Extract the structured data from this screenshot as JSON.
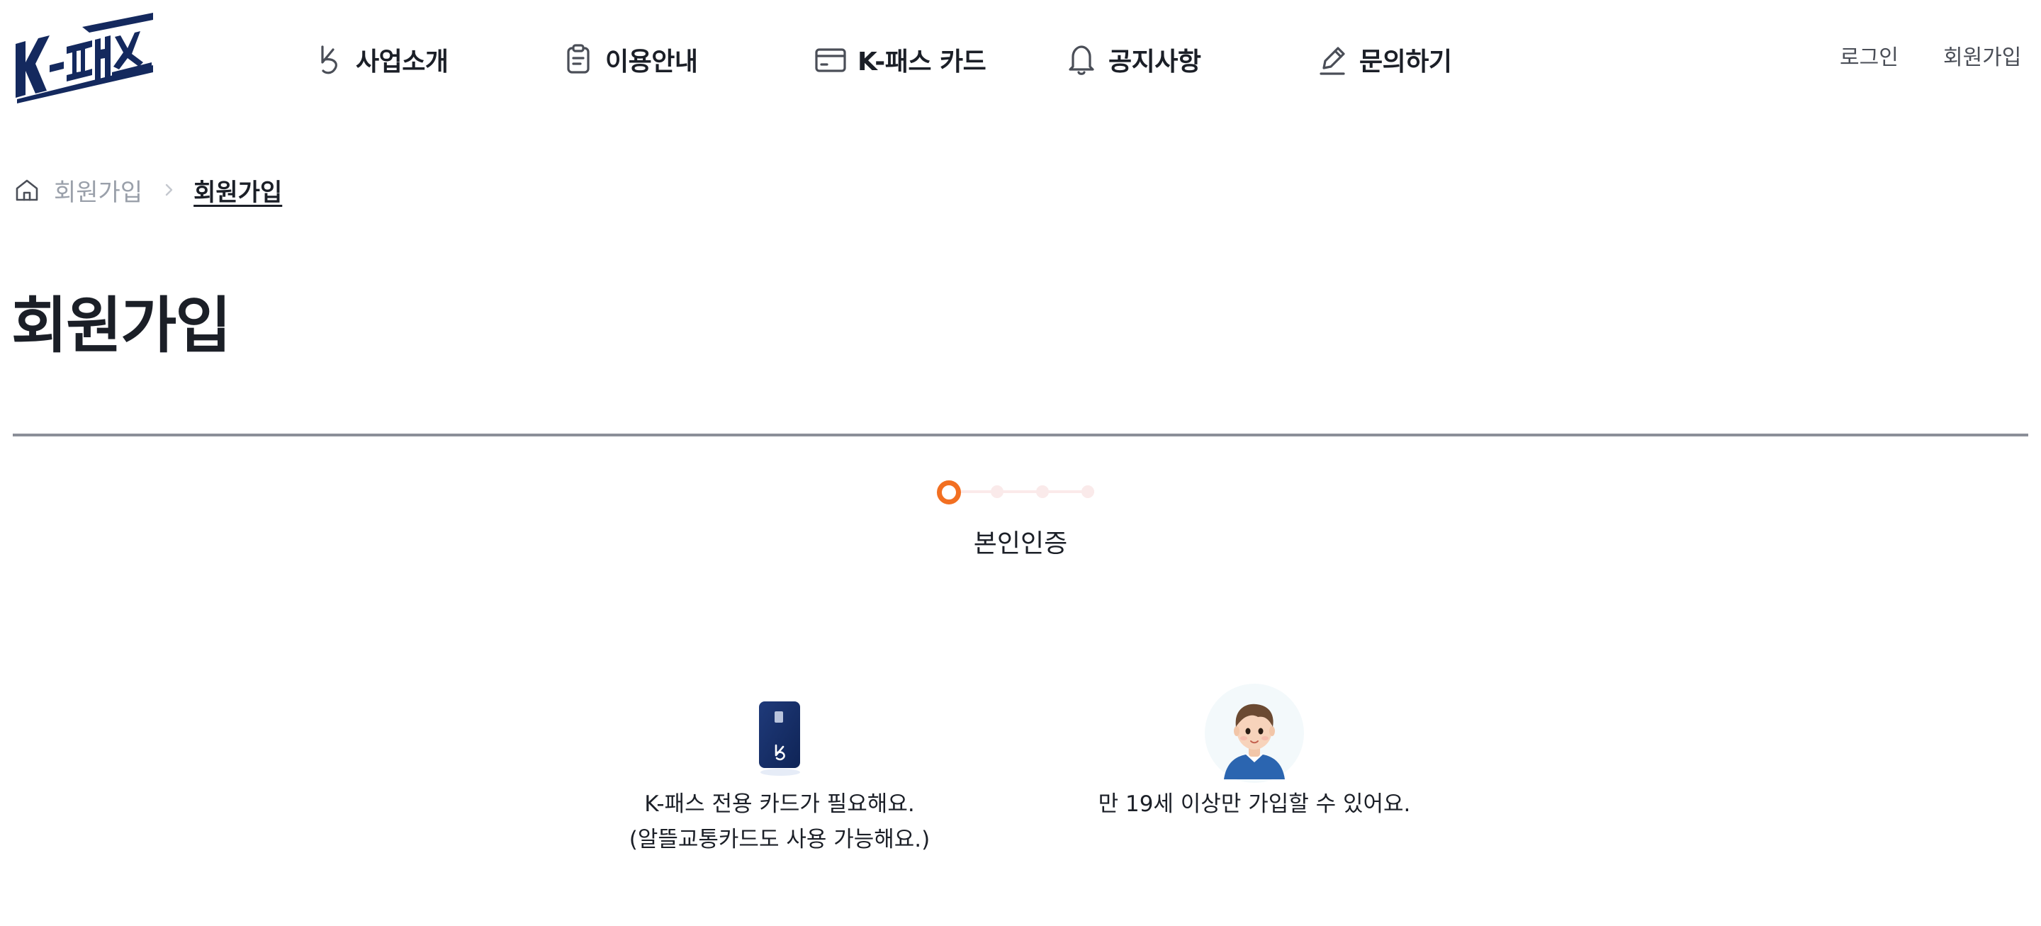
{
  "brand": {
    "logo_text": "K-패스",
    "navy": "#14295e",
    "accent": "#f26f21"
  },
  "gnb": [
    {
      "label": "사업소개",
      "icon": "k-swirl-icon"
    },
    {
      "label": "이용안내",
      "icon": "clipboard-icon"
    },
    {
      "label": "K-패스 카드",
      "icon": "credit-card-icon"
    },
    {
      "label": "공지사항",
      "icon": "bell-icon"
    },
    {
      "label": "문의하기",
      "icon": "pencil-icon"
    }
  ],
  "util": {
    "login": "로그인",
    "join": "회원가입"
  },
  "breadcrumb": {
    "home_icon": "home-icon",
    "parent": "회원가입",
    "current": "회원가입"
  },
  "page": {
    "title": "회원가입"
  },
  "stepper": {
    "total_steps": 4,
    "current_step": 1,
    "current_label": "본인인증"
  },
  "requirements": [
    {
      "illustration": "k-pass-card-icon",
      "line1": "K-패스 전용 카드가 필요해요.",
      "line2": "(알뜰교통카드도 사용 가능해요.)"
    },
    {
      "illustration": "adult-avatar-icon",
      "line1": "만 19세 이상만 가입할 수 있어요."
    }
  ]
}
